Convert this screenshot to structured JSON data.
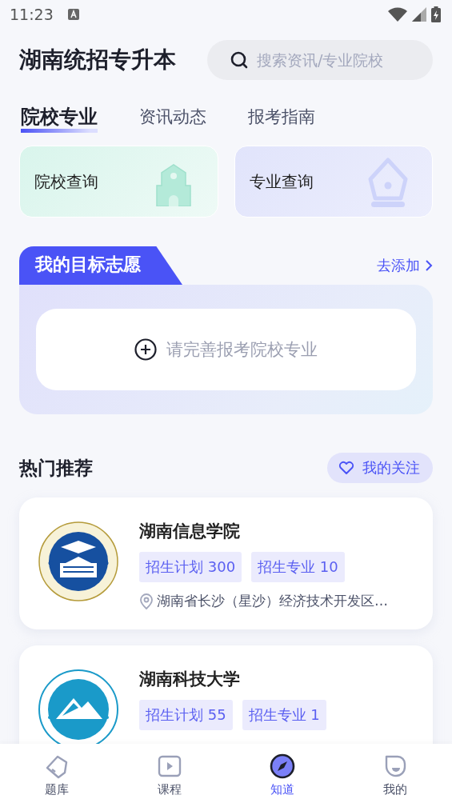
{
  "status_bar": {
    "time": "11:23"
  },
  "header": {
    "title": "湖南统招专升本",
    "search": {
      "placeholder": "搜索资讯/专业院校"
    }
  },
  "tabs": [
    {
      "label": "院校专业",
      "selected": true
    },
    {
      "label": "资讯动态",
      "selected": false
    },
    {
      "label": "报考指南",
      "selected": false
    }
  ],
  "query_cards": [
    {
      "label": "院校查询",
      "kind": "school"
    },
    {
      "label": "专业查询",
      "kind": "major"
    }
  ],
  "target": {
    "title": "我的目标志愿",
    "add_link": "去添加",
    "prompt": "请完善报考院校专业"
  },
  "hot": {
    "title": "热门推荐",
    "follow_button": "我的关注",
    "schools": [
      {
        "name": "湖南信息学院",
        "kind": "info",
        "tags": [
          "招生计划 300",
          "招生专业 10"
        ],
        "address": "湖南省长沙（星沙）经济技术开发区…"
      },
      {
        "name": "湖南科技大学",
        "kind": "tech",
        "tags": [
          "招生计划 55",
          "招生专业 1"
        ]
      }
    ]
  },
  "nav": [
    {
      "label": "题库",
      "kind": "tag",
      "selected": false
    },
    {
      "label": "课程",
      "kind": "play",
      "selected": false
    },
    {
      "label": "知道",
      "kind": "compass",
      "selected": true
    },
    {
      "label": "我的",
      "kind": "face",
      "selected": false
    }
  ]
}
